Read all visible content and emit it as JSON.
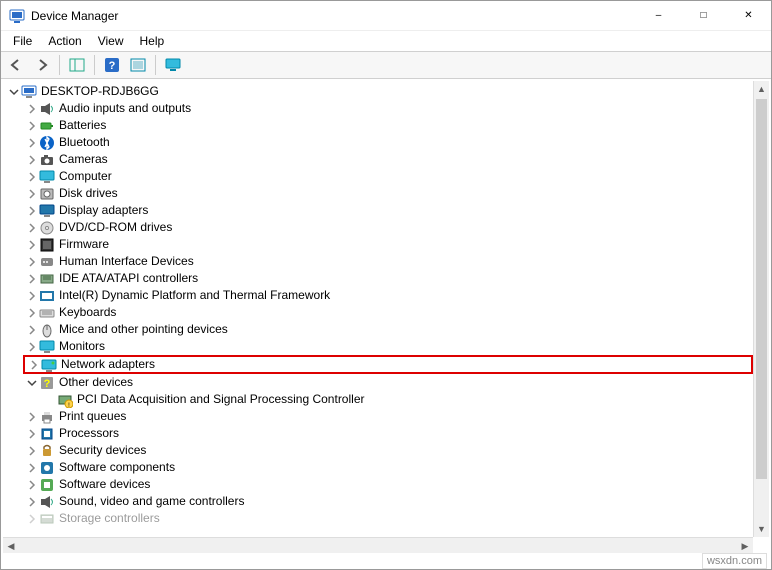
{
  "window": {
    "title": "Device Manager"
  },
  "menu": {
    "file": "File",
    "action": "Action",
    "view": "View",
    "help": "Help"
  },
  "tree": {
    "root": "DESKTOP-RDJB6GG",
    "items": [
      {
        "label": "Audio inputs and outputs",
        "icon": "speaker"
      },
      {
        "label": "Batteries",
        "icon": "battery"
      },
      {
        "label": "Bluetooth",
        "icon": "bluetooth"
      },
      {
        "label": "Cameras",
        "icon": "camera"
      },
      {
        "label": "Computer",
        "icon": "computer"
      },
      {
        "label": "Disk drives",
        "icon": "disk"
      },
      {
        "label": "Display adapters",
        "icon": "display"
      },
      {
        "label": "DVD/CD-ROM drives",
        "icon": "dvd"
      },
      {
        "label": "Firmware",
        "icon": "firmware"
      },
      {
        "label": "Human Interface Devices",
        "icon": "hid"
      },
      {
        "label": "IDE ATA/ATAPI controllers",
        "icon": "ide"
      },
      {
        "label": "Intel(R) Dynamic Platform and Thermal Framework",
        "icon": "intel"
      },
      {
        "label": "Keyboards",
        "icon": "keyboard"
      },
      {
        "label": "Mice and other pointing devices",
        "icon": "mouse"
      },
      {
        "label": "Monitors",
        "icon": "monitor"
      },
      {
        "label": "Network adapters",
        "icon": "network",
        "highlight": true
      },
      {
        "label": "Other devices",
        "icon": "other",
        "expanded": true,
        "children": [
          {
            "label": "PCI Data Acquisition and Signal Processing Controller",
            "icon": "pci-warn"
          }
        ]
      },
      {
        "label": "Print queues",
        "icon": "printer"
      },
      {
        "label": "Processors",
        "icon": "processor"
      },
      {
        "label": "Security devices",
        "icon": "security"
      },
      {
        "label": "Software components",
        "icon": "swcomp"
      },
      {
        "label": "Software devices",
        "icon": "swdev"
      },
      {
        "label": "Sound, video and game controllers",
        "icon": "sound"
      },
      {
        "label": "Storage controllers",
        "icon": "storage",
        "faded": true
      }
    ]
  },
  "watermark": "wsxdn.com"
}
